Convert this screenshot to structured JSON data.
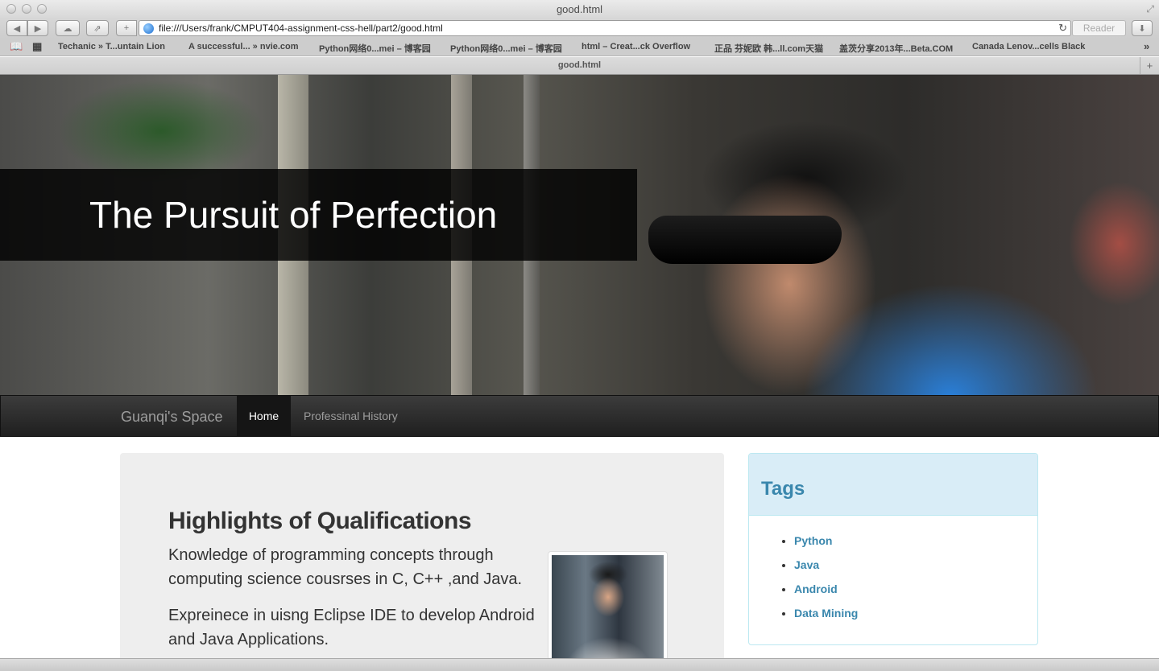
{
  "window": {
    "title": "good.html"
  },
  "toolbar": {
    "url": "file:///Users/frank/CMPUT404-assignment-css-hell/part2/good.html",
    "reader_label": "Reader"
  },
  "bookmarks": [
    "Techanic » T...untain Lion",
    "A successful... » nvie.com",
    "Python网络0...mei – 博客园",
    "Python网络0...mei – 博客园",
    "html – Creat...ck Overflow",
    "正品 芬妮欧 韩...ll.com天猫",
    "盖茨分享2013年...Beta.COM",
    "Canada Lenov...cells Black"
  ],
  "tab": {
    "title": "good.html"
  },
  "hero": {
    "title": "The Pursuit of Perfection"
  },
  "navbar": {
    "brand": "Guanqi's Space",
    "items": [
      {
        "label": "Home",
        "active": true
      },
      {
        "label": "Professinal History",
        "active": false
      }
    ]
  },
  "main": {
    "heading": "Highlights of Qualifications",
    "paragraphs": [
      "Knowledge of programming concepts through computing science cousrses in C, C++ ,and Java.",
      "Expreinece in uisng Eclipse IDE to develop Android and Java Applications."
    ]
  },
  "tags": {
    "title": "Tags",
    "items": [
      "Python",
      "Java",
      "Android",
      "Data Mining"
    ]
  },
  "colors": {
    "navbar_bg": "#222222",
    "panel_heading_bg": "#d9edf7",
    "link": "#3a87ad",
    "well_bg": "#eeeeee"
  }
}
